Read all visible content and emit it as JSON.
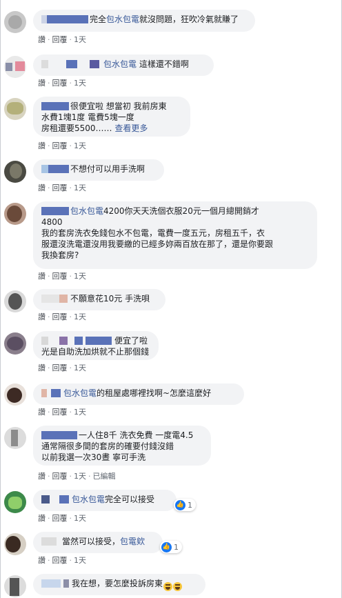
{
  "labels": {
    "like": "讚",
    "reply": "回覆",
    "more": "查看更多"
  },
  "comments": [
    {
      "time": "1天",
      "parts": [
        "完全",
        "包水包電",
        "就沒問題，狂吹冷氣就賺了"
      ]
    },
    {
      "time": "1天",
      "parts": [
        "包水包電",
        " 這樣還不錯啊"
      ]
    },
    {
      "time": "1天",
      "line1": "很便宜啦 想當初 我前房東",
      "line2": "水費1塊1度 電費5塊一度",
      "line3": "房租還要5500……"
    },
    {
      "time": "1天",
      "text": "不想付可以用手洗啊"
    },
    {
      "time": "1天",
      "line1a": "包水包電",
      "line1b": "4200你天天洗個衣服20元一個月總開銷才",
      "line2": "4800",
      "line3": "我的套房洗衣免錢包水不包電，電費一度五元，房租五千，衣",
      "line4": "服還沒洗電還沒用我要繳的已經多妳兩百放在那了，還是你要跟",
      "line5": "我換套房?"
    },
    {
      "time": "1天",
      "text": "不願意花10元 手洗唄"
    },
    {
      "time": "1天",
      "line1": "便宜了啦",
      "line2": "光是自助洗加烘就不止那個錢"
    },
    {
      "time": "1天",
      "tagText": "包水包電",
      "rest": "的租屋處哪裡找啊~怎麼這麼好"
    },
    {
      "time": "1天",
      "edited": "已編輯",
      "line1": "一人住8千 洗衣免費 一度電4.5",
      "line2": "通常隔很多間的套房的確要付錢沒錯",
      "line3": "以前我選一次30晝 寧可手洗"
    },
    {
      "time": "1天",
      "tagText": "包水包電",
      "rest": "完全可以接受",
      "reactCount": "1"
    },
    {
      "time": "1天",
      "text": "當然可以接受，",
      "tagText": "包電欸",
      "reactCount": "1"
    },
    {
      "text": "我在想，要怎麼投訴房東"
    }
  ]
}
